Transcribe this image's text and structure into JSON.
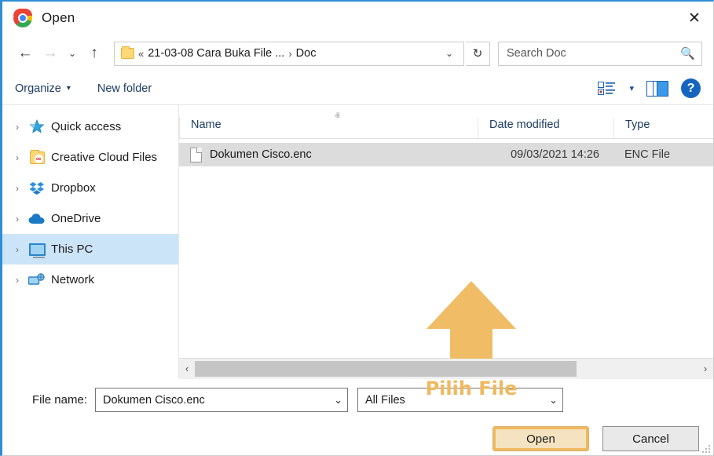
{
  "window": {
    "title": "Open",
    "app_icon": "chrome-logo-icon",
    "close_label": "✕",
    "accent_color": "#2f8ed6"
  },
  "navbar": {
    "back_label": "←",
    "forward_label": "→",
    "history_label": "⌄",
    "up_label": "↑",
    "refresh_label": "↻",
    "breadcrumb": {
      "overflow": "«",
      "parent": "21-03-08 Cara Buka File ...",
      "separator": "›",
      "current": "Doc",
      "caret": "⌄"
    },
    "search": {
      "placeholder": "Search Doc",
      "value": "",
      "icon": "search-icon"
    }
  },
  "commandbar": {
    "organize_label": "Organize",
    "organize_caret": "▾",
    "new_folder_label": "New folder",
    "view_caret": "▾",
    "help_label": "?"
  },
  "sidebar": {
    "items": [
      {
        "label": "Quick access",
        "icon": "star-icon",
        "chevron": "›",
        "selected": false
      },
      {
        "label": "Creative Cloud Files",
        "icon": "creative-cloud-folder-icon",
        "chevron": "›",
        "selected": false
      },
      {
        "label": "Dropbox",
        "icon": "dropbox-icon",
        "chevron": "›",
        "selected": false
      },
      {
        "label": "OneDrive",
        "icon": "onedrive-cloud-icon",
        "chevron": "›",
        "selected": false
      },
      {
        "label": "This PC",
        "icon": "monitor-icon",
        "chevron": "›",
        "selected": true
      },
      {
        "label": "Network",
        "icon": "network-icon",
        "chevron": "›",
        "selected": false
      }
    ],
    "selected_highlight_color": "#cce4f7"
  },
  "filelist": {
    "columns": {
      "name": "Name",
      "date_modified": "Date modified",
      "type": "Type"
    },
    "sort": {
      "column": "Name",
      "direction": "ascending",
      "caret": "ⱏ"
    },
    "rows": [
      {
        "name": "Dokumen Cisco.enc",
        "date_modified": "09/03/2021 14:26",
        "type": "ENC File",
        "icon": "document-icon",
        "selected": true
      }
    ],
    "selection_color": "#dcdcdc",
    "scrollbar": {
      "left_arrow": "‹",
      "right_arrow": "›",
      "thumb_fraction": "76%"
    }
  },
  "annotation": {
    "label": "Pilih File",
    "color": "#f0b95f",
    "arrow_direction": "up"
  },
  "footer": {
    "filename_label": "File name:",
    "filename_value": "Dokumen Cisco.enc",
    "filename_caret": "⌄",
    "filter_value": "All Files",
    "filter_caret": "⌄",
    "open_label": "Open",
    "cancel_label": "Cancel",
    "open_highlight_color": "#f0b95f"
  }
}
